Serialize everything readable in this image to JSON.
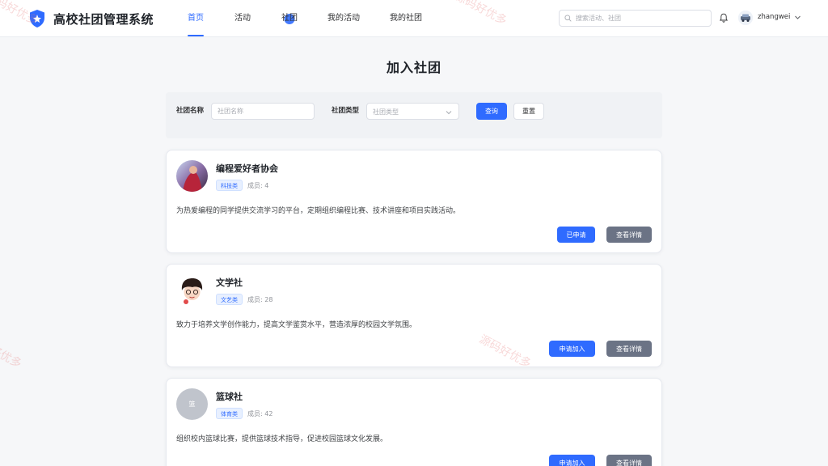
{
  "brand": {
    "title": "高校社团管理系统",
    "logo_icon": "shield-star-icon"
  },
  "nav": [
    {
      "label": "首页",
      "active": true
    },
    {
      "label": "活动",
      "active": false
    },
    {
      "label": "社团",
      "active": false
    },
    {
      "label": "我的活动",
      "active": false
    },
    {
      "label": "我的社团",
      "active": false
    }
  ],
  "header": {
    "search_placeholder": "搜索活动、社团",
    "username": "zhangwei"
  },
  "page": {
    "title": "加入社团"
  },
  "filter": {
    "name_label": "社团名称",
    "name_placeholder": "社团名称",
    "type_label": "社团类型",
    "type_placeholder": "社团类型",
    "query_button": "查询",
    "reset_button": "重置"
  },
  "clubs": [
    {
      "name": "编程爱好者协会",
      "tag": "科技类",
      "members": "成员: 4",
      "description": "为热爱编程的同学提供交流学习的平台，定期组织编程比赛、技术讲座和项目实践活动。",
      "action_label": "已申请",
      "detail_label": "查看详情"
    },
    {
      "name": "文学社",
      "tag": "文艺类",
      "members": "成员: 28",
      "description": "致力于培养文学创作能力，提高文学鉴赏水平，营造浓厚的校园文学氛围。",
      "action_label": "申请加入",
      "detail_label": "查看详情"
    },
    {
      "name": "篮球社",
      "tag": "体育类",
      "members": "成员: 42",
      "description": "组织校内篮球比赛，提供篮球技术指导，促进校园篮球文化发展。",
      "action_label": "申请加入",
      "detail_label": "查看详情",
      "avatar_text": "篮"
    }
  ],
  "watermark": "源码好优多",
  "colors": {
    "primary": "#2f6bff",
    "detail_button": "#6b7385",
    "tag_bg": "#e8f0ff"
  }
}
